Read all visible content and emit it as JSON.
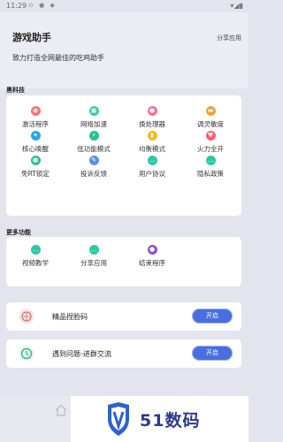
{
  "status_bar": {
    "time": "11:29",
    "icons": "⊙ ● ◆",
    "right_icons": "▾◢▮"
  },
  "header": {
    "title": "游戏助手",
    "share_label": "分享应用",
    "slogan": "致力打造全网最佳的吃鸡助手"
  },
  "black_tech": {
    "section_title": "黑科技",
    "items": [
      {
        "label": "激活程序",
        "icon": "activate-icon",
        "color": "#ff6f6f",
        "glyph": "◉"
      },
      {
        "label": "网络加速",
        "icon": "network-icon",
        "color": "#3ec7b0",
        "glyph": "▣"
      },
      {
        "label": "换处理器",
        "icon": "processor-icon",
        "color": "#ff6f8f",
        "glyph": "●"
      },
      {
        "label": "调灵敏度",
        "icon": "sensitivity-icon",
        "color": "#f2a23c",
        "glyph": "▬"
      },
      {
        "label": "核心唤醒",
        "icon": "core-icon",
        "color": "#2aa7e8",
        "glyph": "✦"
      },
      {
        "label": "低功能模式",
        "icon": "low-power-icon",
        "color": "#2dbf8f",
        "glyph": "⚡"
      },
      {
        "label": "均衡模式",
        "icon": "balance-icon",
        "color": "#f5b820",
        "glyph": "▮"
      },
      {
        "label": "火力全开",
        "icon": "fire-icon",
        "color": "#ff5f6b",
        "glyph": "♥"
      },
      {
        "label": "免RT锁定",
        "icon": "lock-icon",
        "color": "#29c48a",
        "glyph": "●"
      },
      {
        "label": "投诉反馈",
        "icon": "feedback-icon",
        "color": "#5b8fe8",
        "glyph": "✎"
      },
      {
        "label": "用户协议",
        "icon": "agreement-icon",
        "color": "#2ec7a5",
        "glyph": "…"
      },
      {
        "label": "隐私政策",
        "icon": "privacy-icon",
        "color": "#2ec7a5",
        "glyph": "…"
      }
    ]
  },
  "more": {
    "section_title": "更多功能",
    "items": [
      {
        "label": "视频教学",
        "icon": "video-icon",
        "color": "#2ec7a5",
        "glyph": "…"
      },
      {
        "label": "分享应用",
        "icon": "share-icon",
        "color": "#2ec7a5",
        "glyph": "…"
      },
      {
        "label": "结束程序",
        "icon": "end-icon",
        "color": "#8a4fd8",
        "glyph": "●"
      }
    ]
  },
  "rows": [
    {
      "label": "精品捏脸码",
      "icon": "face-code-icon",
      "button": "开启"
    },
    {
      "label": "遇到问题-进群交流",
      "icon": "group-chat-icon",
      "button": "开启"
    }
  ],
  "watermark": {
    "text": "51数码"
  },
  "colors": {
    "accent": "#4a6fdc",
    "background": "#e4e4ee",
    "watermark_text": "#2e3a8c"
  }
}
